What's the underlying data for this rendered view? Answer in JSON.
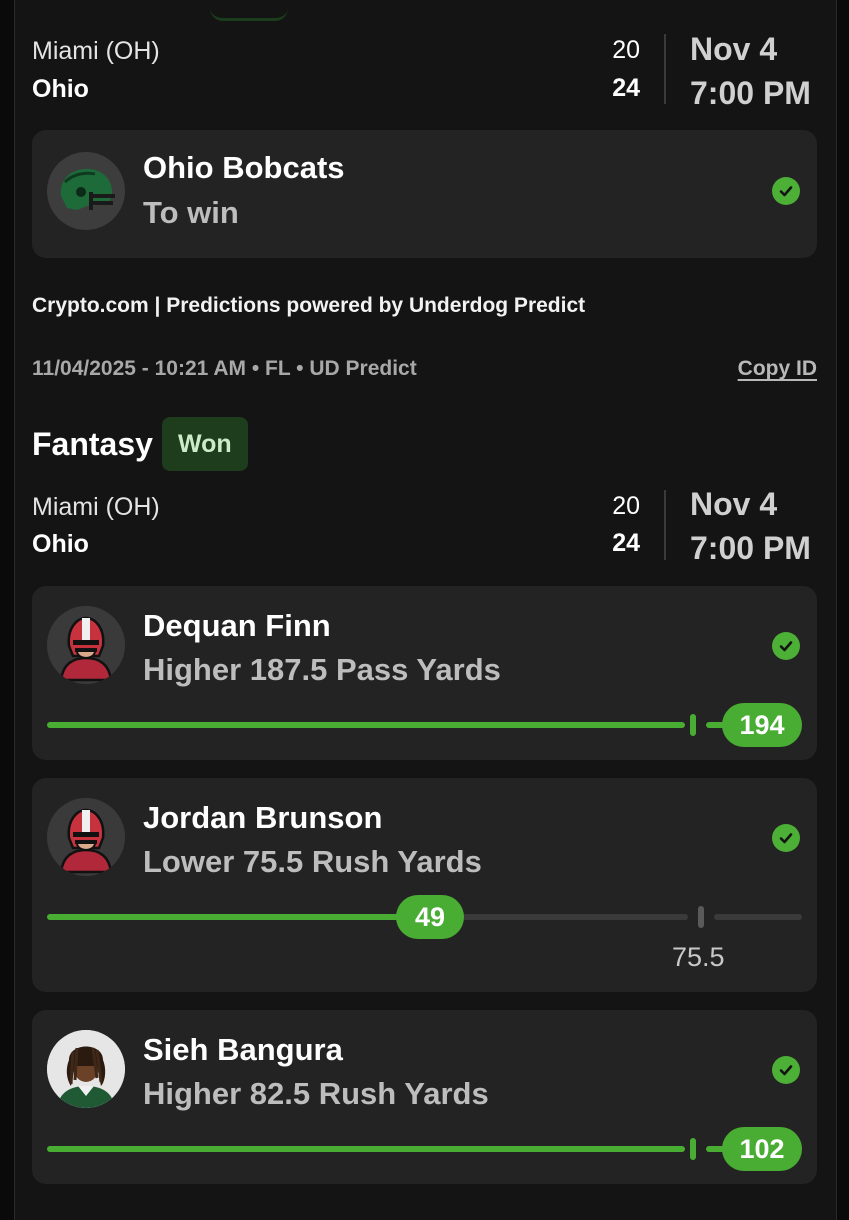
{
  "game1": {
    "away_team": "Miami (OH)",
    "away_score": "20",
    "home_team": "Ohio",
    "home_score": "24",
    "date": "Nov 4",
    "time": "7:00 PM"
  },
  "pick1": {
    "title": "Ohio Bobcats",
    "subtitle": "To win",
    "status_icon": "check-circle-icon",
    "avatar_icon": "helmet-icon",
    "helmet_color": "#1e6b3a"
  },
  "footer": {
    "powered_by": "Crypto.com | Predictions powered by Underdog Predict",
    "meta": "11/04/2025 - 10:21 AM • FL • UD Predict",
    "copy_id": "Copy ID"
  },
  "fantasy": {
    "title": "Fantasy",
    "status": "Won"
  },
  "game2": {
    "away_team": "Miami (OH)",
    "away_score": "20",
    "home_team": "Ohio",
    "home_score": "24",
    "date": "Nov 4",
    "time": "7:00 PM"
  },
  "picks": [
    {
      "name": "Dequan Finn",
      "pick": "Higher 187.5 Pass Yards",
      "line": 187.5,
      "result": "194",
      "result_value": 194,
      "avatar_icon": "player-silhouette-icon"
    },
    {
      "name": "Jordan Brunson",
      "pick": "Lower 75.5 Rush Yards",
      "line": 75.5,
      "line_label": "75.5",
      "result": "49",
      "result_value": 49,
      "avatar_icon": "player-silhouette-icon"
    },
    {
      "name": "Sieh Bangura",
      "pick": "Higher 82.5 Rush Yards",
      "line": 82.5,
      "result": "102",
      "result_value": 102,
      "avatar_icon": "player-photo"
    }
  ],
  "colors": {
    "accent_green": "#49ad34",
    "badge_bg": "#1d3d1c",
    "card_bg": "#232323",
    "page_bg": "#141414"
  }
}
